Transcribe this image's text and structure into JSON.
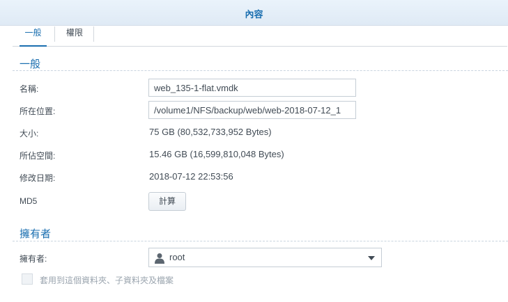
{
  "window": {
    "title": "內容"
  },
  "tabs": [
    {
      "label": "一般",
      "active": true
    },
    {
      "label": "權限",
      "active": false
    }
  ],
  "general": {
    "section_title": "一般",
    "name": {
      "label": "名稱:",
      "value": "web_135-1-flat.vmdk"
    },
    "location": {
      "label": "所在位置:",
      "value": "/volume1/NFS/backup/web/web-2018-07-12_1"
    },
    "size": {
      "label": "大小:",
      "value": "75 GB (80,532,733,952 Bytes)"
    },
    "used_space": {
      "label": "所佔空間:",
      "value": "15.46 GB (16,599,810,048 Bytes)"
    },
    "modified": {
      "label": "修改日期:",
      "value": "2018-07-12 22:53:56"
    },
    "md5": {
      "label": "MD5",
      "button_label": "計算"
    }
  },
  "owner": {
    "section_title": "擁有者",
    "label": "擁有者:",
    "selected": "root",
    "icon": "user-icon",
    "apply_subfolders_label": "套用到這個資料夾、子資料夾及檔案",
    "apply_subfolders_checked": false
  },
  "colors": {
    "accent": "#1b6fb0",
    "text": "#414b55",
    "disabled_text": "#9aa4ae"
  }
}
